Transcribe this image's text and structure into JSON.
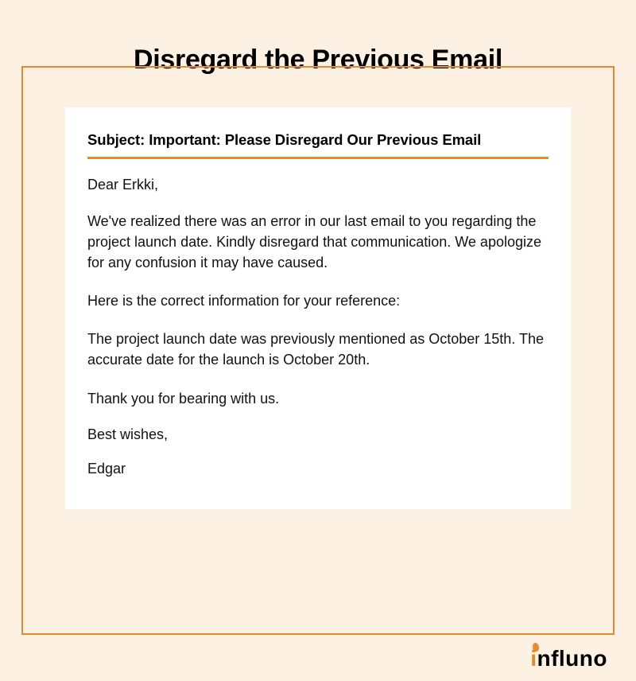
{
  "page": {
    "title": "Disregard the Previous Email"
  },
  "email": {
    "subject_prefix": "Subject: ",
    "subject_text": "Important: Please Disregard Our Previous Email",
    "greeting": "Dear Erkki,",
    "para1": "We've realized there was an error in our last email to you regarding the project launch date. Kindly disregard that communication. We apologize for any confusion it may have caused.",
    "para2": "Here is the correct information for your reference:",
    "para3": "The project launch date was previously mentioned as October 15th. The accurate date for the launch is October 20th.",
    "para4": "Thank you for bearing with us.",
    "closing": "Best wishes,",
    "signature": "Edgar"
  },
  "brand": {
    "name": "influno"
  },
  "colors": {
    "accent": "#e58a2f",
    "background": "#fcf1e3",
    "card_bg": "#ffffff",
    "text": "#000000"
  }
}
